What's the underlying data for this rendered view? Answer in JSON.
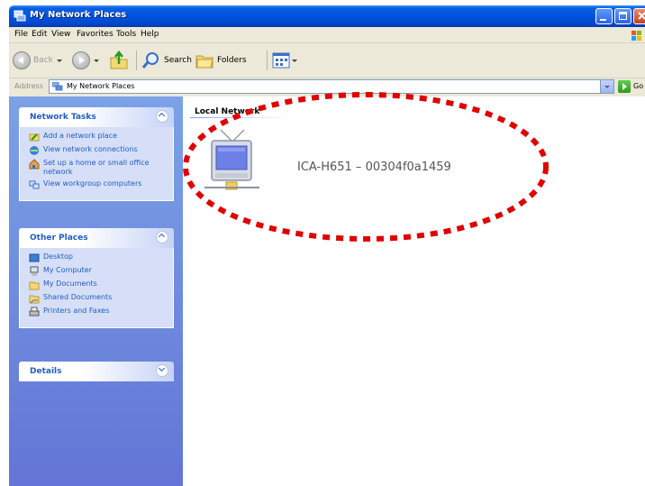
{
  "window": {
    "title": "My Network Places"
  },
  "menu": [
    "File",
    "Edit",
    "View",
    "Favorites",
    "Tools",
    "Help"
  ],
  "toolbar": {
    "back_label": "Back",
    "search_label": "Search",
    "folders_label": "Folders"
  },
  "address": {
    "label": "Address",
    "value": "My Network Places",
    "go_label": "Go"
  },
  "network_tasks": {
    "title": "Network Tasks",
    "items": [
      {
        "label": "Add a network place",
        "icon": "add-network-place-icon"
      },
      {
        "label": "View network connections",
        "icon": "network-connections-icon"
      },
      {
        "label": "Set up a home or small office network",
        "icon": "home-network-icon"
      },
      {
        "label": "View workgroup computers",
        "icon": "workgroup-icon"
      }
    ]
  },
  "other_places": {
    "title": "Other Places",
    "items": [
      {
        "label": "Desktop",
        "icon": "desktop-icon"
      },
      {
        "label": "My Computer",
        "icon": "computer-icon"
      },
      {
        "label": "My Documents",
        "icon": "documents-folder-icon"
      },
      {
        "label": "Shared Documents",
        "icon": "shared-folder-icon"
      },
      {
        "label": "Printers and Faxes",
        "icon": "printer-icon"
      }
    ]
  },
  "details": {
    "title": "Details"
  },
  "content": {
    "group_header": "Local Network",
    "items": [
      {
        "name": "ICA-H651 – 00304f0a1459",
        "icon": "network-device-icon"
      }
    ]
  },
  "colors": {
    "title_bar": "#0054e3",
    "task_pane": "#6f8fdf",
    "link": "#215dc6",
    "highlight_oval": "#e00000"
  }
}
